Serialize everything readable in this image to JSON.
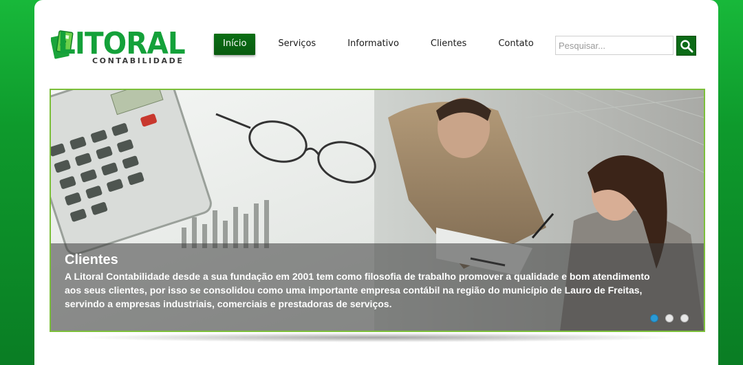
{
  "brand": {
    "name": "LITORAL",
    "subtitle": "CONTABILIDADE",
    "color": "#14a13a"
  },
  "nav": {
    "items": [
      {
        "label": "Início",
        "active": true
      },
      {
        "label": "Serviços",
        "active": false
      },
      {
        "label": "Informativo",
        "active": false
      },
      {
        "label": "Clientes",
        "active": false
      },
      {
        "label": "Contato",
        "active": false
      }
    ],
    "active_color": "#0a6f14"
  },
  "search": {
    "placeholder": "Pesquisar...",
    "value": "",
    "icon": "search-icon"
  },
  "slider": {
    "caption_title": "Clientes",
    "caption_text": "A Litoral Contabilidade desde a sua fundação em 2001 tem como filosofia de trabalho promover a qualidade e bom atendimento aos seus clientes, por isso se consolidou como uma importante empresa contábil na região do município de Lauro de Freitas, servindo a empresas industriais, comerciais e prestadoras de serviços.",
    "slide_count": 3,
    "active_slide": 1,
    "border_color": "#7cbf3a",
    "active_dot_color": "#2a9ad6"
  },
  "background_color": "#0e9a2c"
}
